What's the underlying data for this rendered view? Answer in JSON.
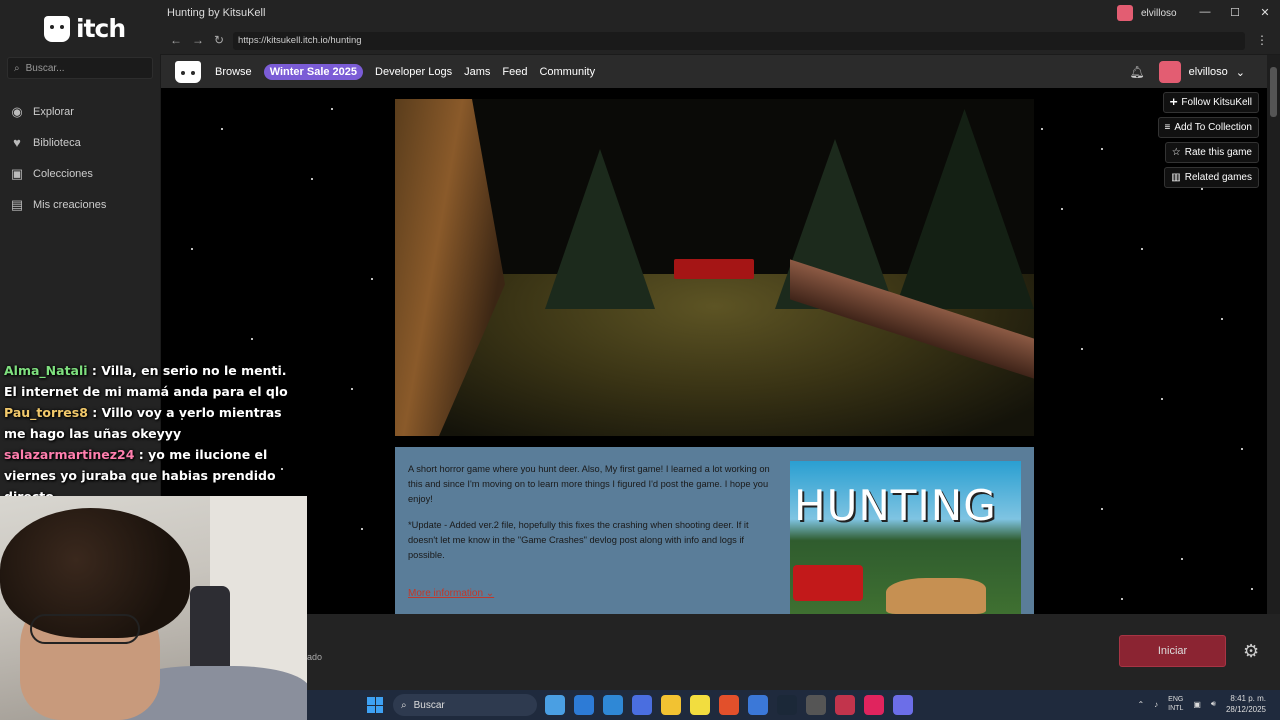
{
  "app": {
    "logo_text": "itch",
    "search_placeholder": "Buscar...",
    "nav": [
      {
        "label": "Explorar",
        "icon": "compass-icon"
      },
      {
        "label": "Biblioteca",
        "icon": "heart-icon"
      },
      {
        "label": "Colecciones",
        "icon": "collection-icon"
      },
      {
        "label": "Mis creaciones",
        "icon": "creations-icon"
      }
    ]
  },
  "window": {
    "title": "Hunting by KitsuKell",
    "username": "elvilloso",
    "controls": [
      "—",
      "☐",
      "✕"
    ]
  },
  "address": {
    "url": "https://kitsukell.itch.io/hunting"
  },
  "site_header": {
    "nav": [
      "Browse",
      "Winter Sale 2025",
      "Developer Logs",
      "Jams",
      "Feed",
      "Community"
    ],
    "username": "elvilloso"
  },
  "actions": {
    "follow": "Follow KitsuKell",
    "add_collection": "Add To Collection",
    "rate": "Rate this game",
    "related": "Related games"
  },
  "description": {
    "paragraph1": "A short horror game where you hunt deer.  Also, My first game! I learned a lot working on this and since I'm moving on to learn more things I figured I'd post the game. I hope you enjoy!",
    "paragraph2": "*Update - Added ver.2 file, hopefully this fixes the crashing when shooting deer. If it doesn't let me know in the \"Game Crashes\" devlog post along with info and logs if possible.",
    "more_link": "More information",
    "cover_title": "HUNTING"
  },
  "chat": [
    {
      "user": "Alma_Natali",
      "color": "#7fe07f",
      "text": ": Villa, en serio no le menti. El internet de mi mamá anda para el qlo"
    },
    {
      "user": "Pau_torres8",
      "color": "#f2c96b",
      "text": ": Villo voy a verlo mientras me hago las uñas okeyyy"
    },
    {
      "user": "salazarmartinez24",
      "color": "#ff7fae",
      "text": ": yo me ilucione el viernes yo juraba que habias prendido directo"
    }
  ],
  "launch": {
    "status_text": "ado",
    "button": "Iniciar"
  },
  "taskbar": {
    "search": "Buscar",
    "lang_top": "ENG",
    "lang_bottom": "INTL",
    "time": "8:41 p. m.",
    "date": "28/12/2025",
    "apps": [
      "#4a9fe3",
      "#2d7bd6",
      "#2f88d6",
      "#4a6ee0",
      "#f2c232",
      "#f2dd3f",
      "#e2502b",
      "#3b78d8",
      "#1b2838",
      "#555",
      "#c2344c",
      "#e0245e",
      "#6c6ee8"
    ]
  }
}
